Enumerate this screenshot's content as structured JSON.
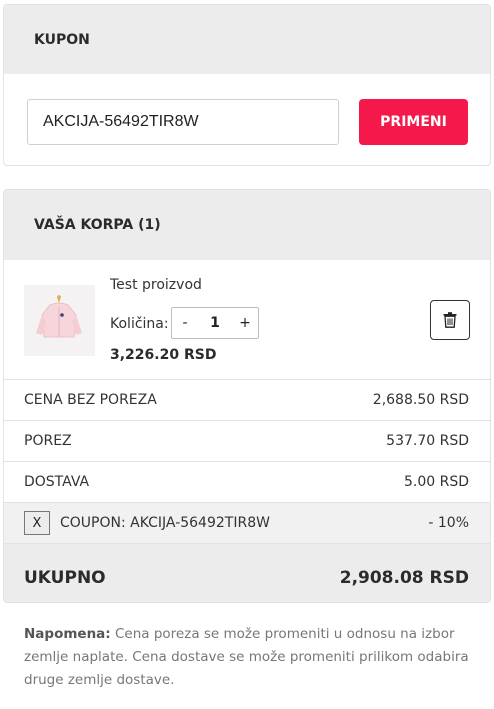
{
  "coupon": {
    "title": "KUPON",
    "input_value": "AKCIJA-56492TIR8W",
    "apply_label": "PRIMENI"
  },
  "cart": {
    "title": "VAŠA KORPA (1)",
    "item": {
      "name": "Test proizvod",
      "qty_label": "Količina:",
      "qty_minus": "-",
      "qty_value": "1",
      "qty_plus": "+",
      "price": "3,226.20 RSD"
    },
    "summary": [
      {
        "label": "CENA BEZ POREZA",
        "value": "2,688.50 RSD"
      },
      {
        "label": "POREZ",
        "value": "537.70 RSD"
      },
      {
        "label": "DOSTAVA",
        "value": "5.00 RSD"
      }
    ],
    "coupon_row": {
      "remove_label": "X",
      "label": "COUPON: AKCIJA-56492TIR8W",
      "value": "- 10%"
    },
    "total": {
      "label": "UKUPNO",
      "value": "2,908.08 RSD"
    }
  },
  "note": {
    "prefix": "Napomena:",
    "text": " Cena poreza se može promeniti u odnosu na izbor zemlje naplate. Cena dostave se može promeniti prilikom odabira druge zemlje dostave."
  },
  "colors": {
    "accent": "#f5184b",
    "header_bg": "#ececec"
  },
  "icons": {
    "delete": "trash-icon",
    "product": "jacket-thumbnail"
  }
}
